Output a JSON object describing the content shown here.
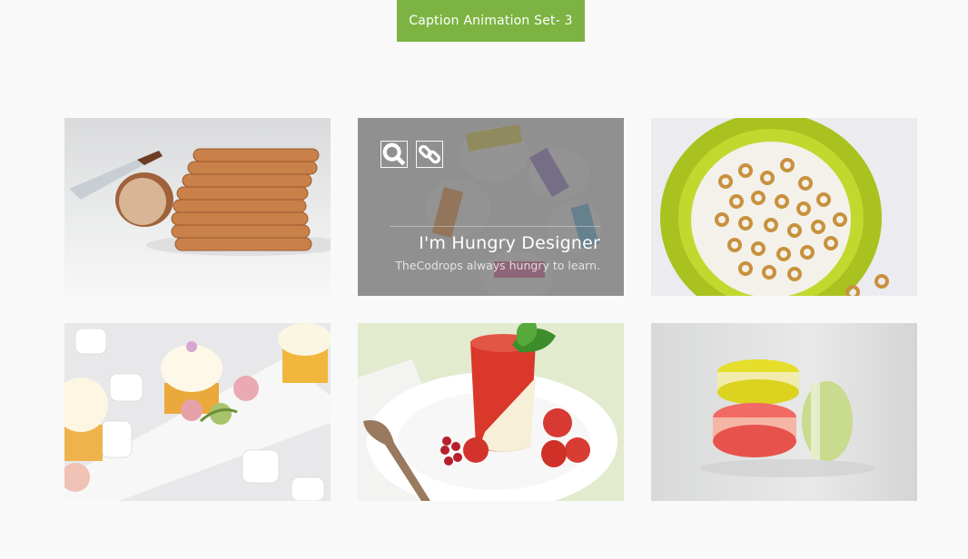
{
  "header": {
    "badge_label": "Caption Animation Set- 3",
    "accent_color": "#7cb342"
  },
  "gallery": {
    "items": [
      {
        "subject": "sliced bread with knife",
        "icon": "bread-photo"
      },
      {
        "subject": "decorated eggs with ribbons",
        "icon": "eggs-photo",
        "caption": {
          "title": "I'm Hungry Designer",
          "subtitle": "TheCodrops always hungry to learn.",
          "actions": [
            "search-icon",
            "link-icon"
          ]
        }
      },
      {
        "subject": "cereal bowl with milk",
        "icon": "cereal-photo"
      },
      {
        "subject": "cupcakes and marshmallows",
        "icon": "cupcake-photo"
      },
      {
        "subject": "strawberry panna cotta dessert",
        "icon": "dessert-photo"
      },
      {
        "subject": "macarons",
        "icon": "macaron-photo"
      }
    ]
  }
}
